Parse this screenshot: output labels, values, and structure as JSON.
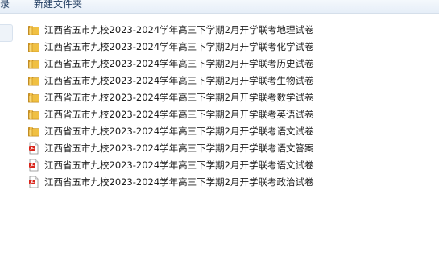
{
  "toolbar": {
    "partial_label": "录",
    "new_folder_label": "新建文件夹"
  },
  "files": [
    {
      "name": "江西省五市九校2023-2024学年高三下学期2月开学联考地理试卷",
      "type": "folder",
      "icon": "folder-icon"
    },
    {
      "name": "江西省五市九校2023-2024学年高三下学期2月开学联考化学试卷",
      "type": "folder",
      "icon": "folder-icon"
    },
    {
      "name": "江西省五市九校2023-2024学年高三下学期2月开学联考历史试卷",
      "type": "folder",
      "icon": "folder-icon"
    },
    {
      "name": "江西省五市九校2023-2024学年高三下学期2月开学联考生物试卷",
      "type": "folder",
      "icon": "folder-icon"
    },
    {
      "name": "江西省五市九校2023-2024学年高三下学期2月开学联考数学试卷",
      "type": "folder",
      "icon": "folder-icon"
    },
    {
      "name": "江西省五市九校2023-2024学年高三下学期2月开学联考英语试卷",
      "type": "folder",
      "icon": "folder-icon"
    },
    {
      "name": "江西省五市九校2023-2024学年高三下学期2月开学联考语文试卷",
      "type": "folder",
      "icon": "folder-icon"
    },
    {
      "name": "江西省五市九校2023-2024学年高三下学期2月开学联考语文答案",
      "type": "pdf",
      "icon": "pdf-icon"
    },
    {
      "name": "江西省五市九校2023-2024学年高三下学期2月开学联考语文试卷",
      "type": "pdf",
      "icon": "pdf-icon"
    },
    {
      "name": "江西省五市九校2023-2024学年高三下学期2月开学联考政治试卷",
      "type": "pdf",
      "icon": "pdf-icon"
    }
  ],
  "colors": {
    "folder": "#e8b43a",
    "pdf_red": "#d9261c"
  }
}
